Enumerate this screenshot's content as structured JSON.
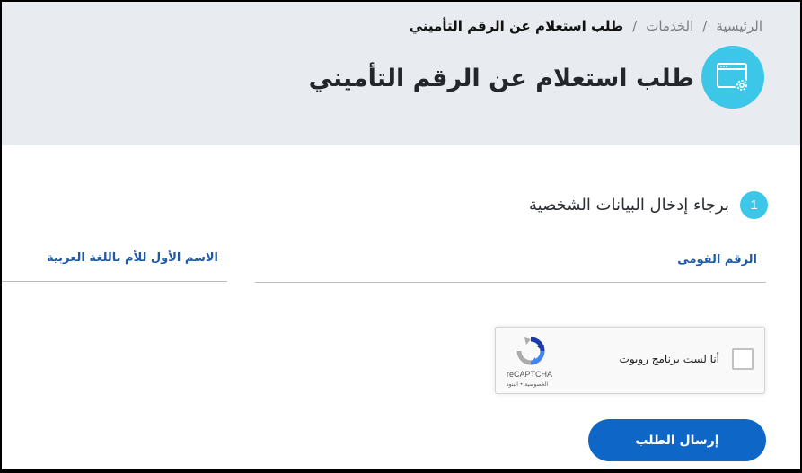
{
  "breadcrumb": {
    "items": [
      "الرئيسية",
      "الخدمات"
    ],
    "separator": "/",
    "current": "طلب استعلام عن الرقم التأميني"
  },
  "page": {
    "title": "طلب استعلام عن الرقم التأميني",
    "icon": "window-gear-icon"
  },
  "section": {
    "step": "1",
    "title": "برجاء إدخال البيانات الشخصية"
  },
  "fields": {
    "national_id": {
      "label": "الرقم القومى",
      "value": ""
    },
    "mother_first_name_ar": {
      "label": "الاسم الأول للأم باللغة العربية",
      "value": ""
    }
  },
  "recaptcha": {
    "label": "أنا لست برنامج روبوت",
    "brand": "reCAPTCHA",
    "terms": "الخصوصية • البنود",
    "checked": false
  },
  "submit_label": "إرسال الطلب",
  "colors": {
    "header_bg": "#e8ecf1",
    "accent": "#3cc6e8",
    "primary": "#0e66c6",
    "field_label": "#1f5aa8"
  }
}
